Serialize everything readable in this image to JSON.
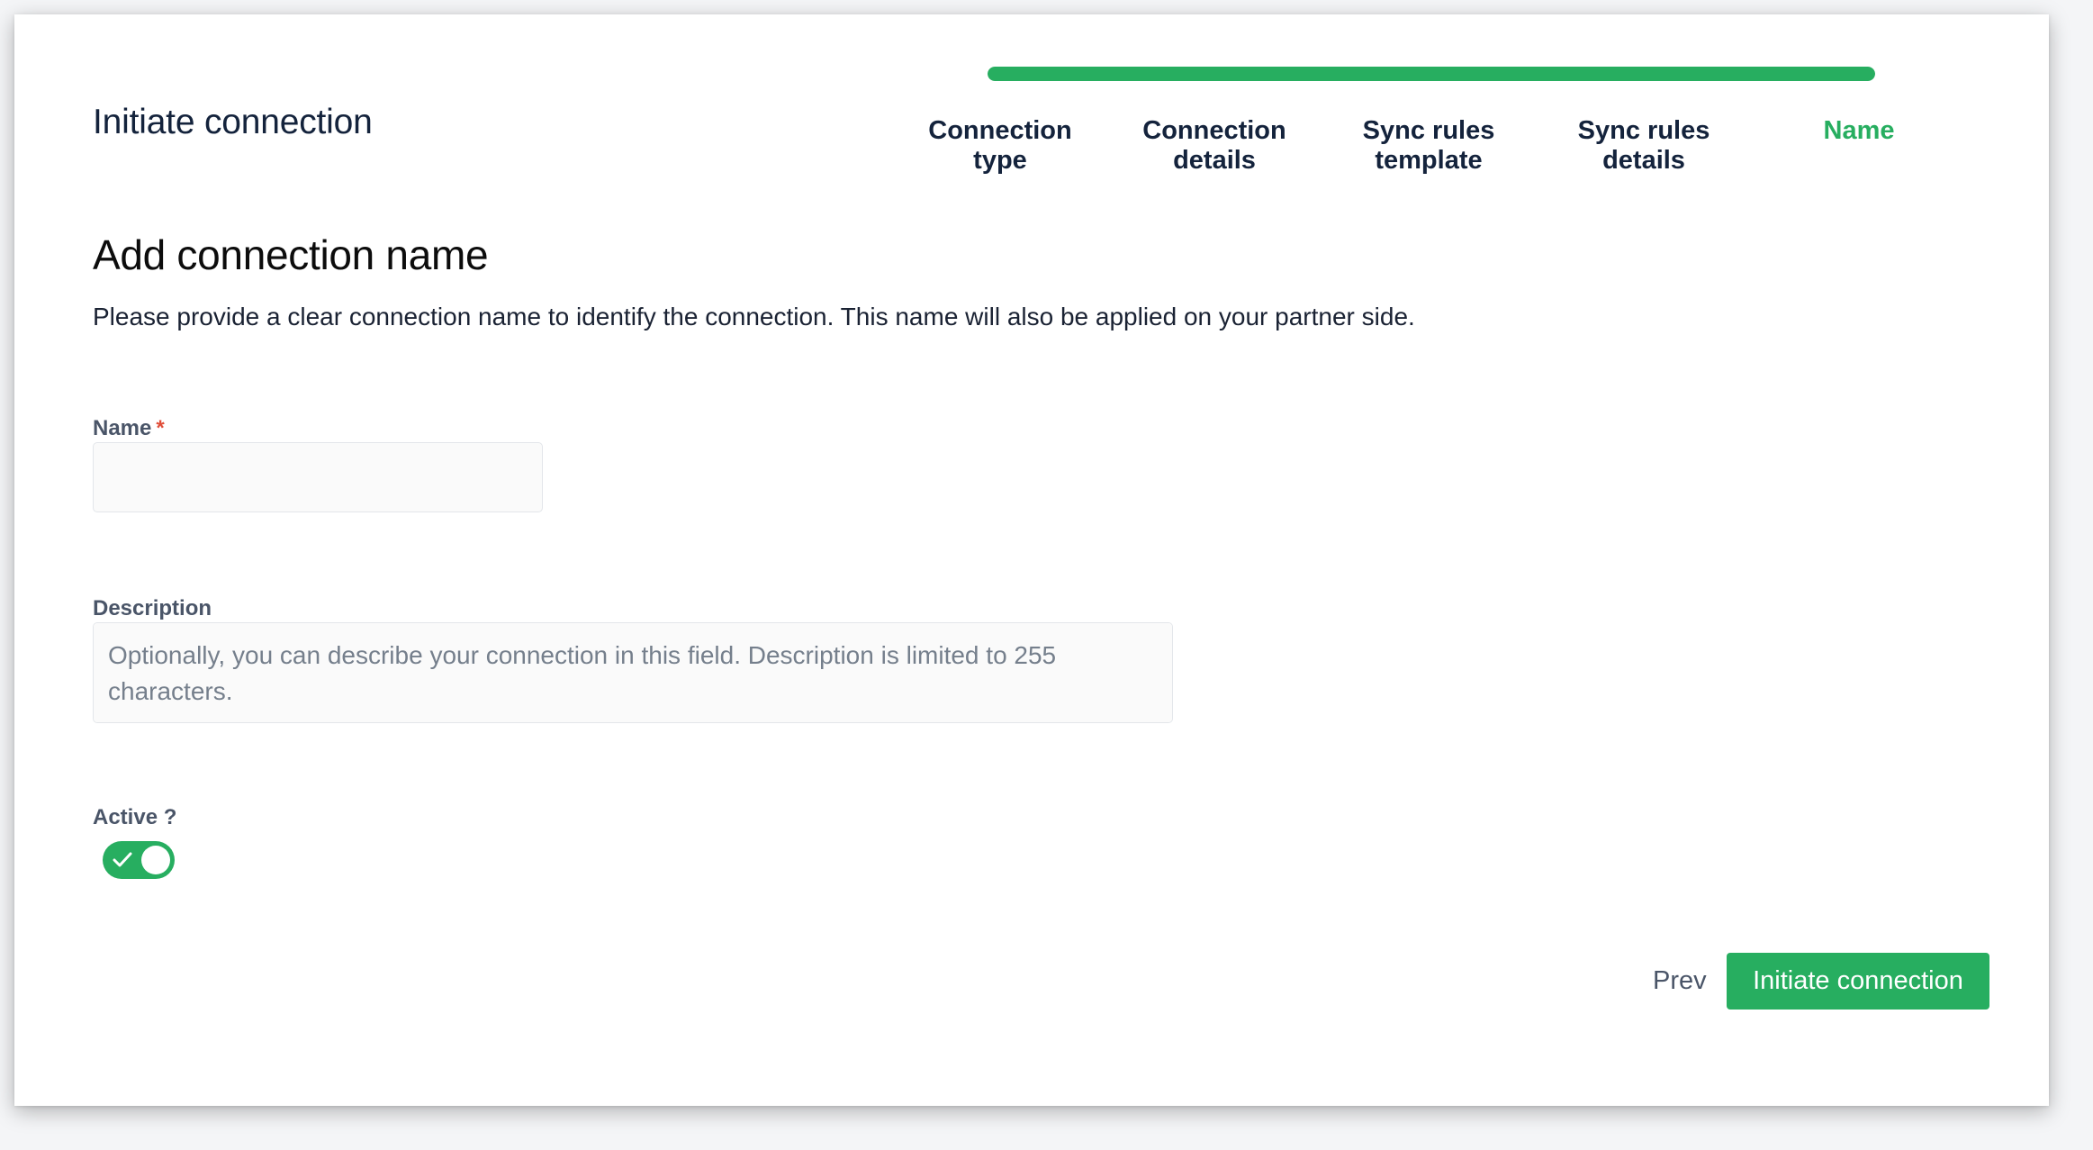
{
  "header": {
    "title": "Initiate connection"
  },
  "wizard": {
    "progress": 1.0,
    "steps": [
      {
        "label": "Connection\ntype",
        "state": "completed"
      },
      {
        "label": "Connection\ndetails",
        "state": "completed"
      },
      {
        "label": "Sync rules\ntemplate",
        "state": "completed"
      },
      {
        "label": "Sync rules\ndetails",
        "state": "completed"
      },
      {
        "label": "Name",
        "state": "current"
      }
    ]
  },
  "section": {
    "title": "Add connection name",
    "description": "Please provide a clear connection name to identify the connection. This name will also be applied on your partner side."
  },
  "form": {
    "name": {
      "label": "Name",
      "required_mark": "*",
      "value": "",
      "placeholder": ""
    },
    "description": {
      "label": "Description",
      "value": "",
      "placeholder": "Optionally, you can describe your connection in this field. Description is limited to 255 characters."
    },
    "active": {
      "label": "Active ?",
      "checked": true,
      "icon": "check-icon"
    }
  },
  "actions": {
    "prev_label": "Prev",
    "submit_label": "Initiate connection"
  },
  "colors": {
    "accent": "#27ae60",
    "title": "#14233c",
    "label": "#4a5568",
    "required": "#e04e39"
  }
}
